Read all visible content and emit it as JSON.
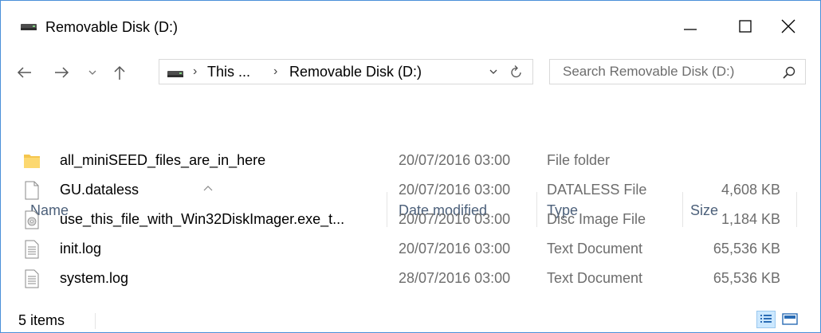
{
  "window": {
    "title": "Removable Disk (D:)",
    "accent_border": "#4a90d9"
  },
  "nav": {
    "back_icon": "arrow-left-icon",
    "forward_icon": "arrow-right-icon",
    "recent_icon": "chevron-down-icon",
    "up_icon": "arrow-up-icon"
  },
  "address": {
    "crumbs": [
      "This ...",
      "Removable Disk (D:)"
    ],
    "separator": "›"
  },
  "search": {
    "placeholder": "Search Removable Disk (D:)"
  },
  "columns": {
    "name": "Name",
    "date": "Date modified",
    "type": "Type",
    "size": "Size",
    "sorted_by": "name"
  },
  "files": [
    {
      "name": "all_miniSEED_files_are_in_here",
      "date": "20/07/2016 03:00",
      "type": "File folder",
      "size": "",
      "icon": "folder-icon"
    },
    {
      "name": "GU.dataless",
      "date": "20/07/2016 03:00",
      "type": "DATALESS File",
      "size": "4,608 KB",
      "icon": "file-icon"
    },
    {
      "name": "use_this_file_with_Win32DiskImager.exe_t...",
      "date": "20/07/2016 03:00",
      "type": "Disc Image File",
      "size": "1,184 KB",
      "icon": "disc-image-icon"
    },
    {
      "name": "init.log",
      "date": "20/07/2016 03:00",
      "type": "Text Document",
      "size": "65,536 KB",
      "icon": "text-document-icon"
    },
    {
      "name": "system.log",
      "date": "28/07/2016 03:00",
      "type": "Text Document",
      "size": "65,536 KB",
      "icon": "text-document-icon"
    }
  ],
  "status": {
    "item_count": "5 items",
    "active_view": "details"
  }
}
